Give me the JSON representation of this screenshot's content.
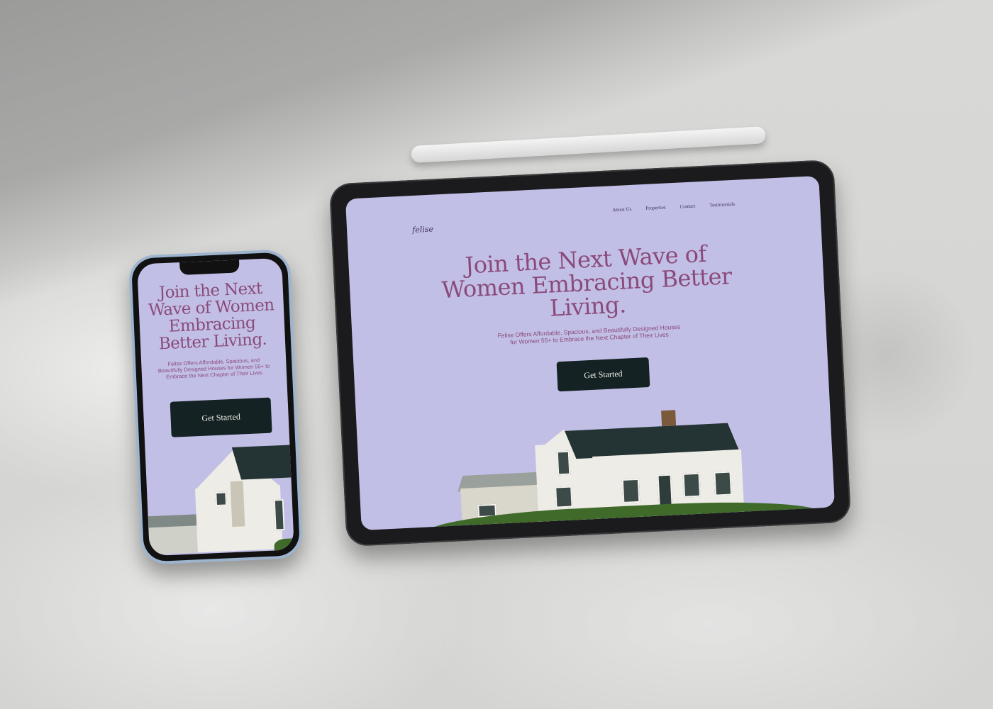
{
  "brand": {
    "logo": "felise"
  },
  "nav": {
    "items": [
      "About Us",
      "Properties",
      "Contact",
      "Testimonials"
    ]
  },
  "hero": {
    "title": "Join the Next Wave of Women Embracing Better Living.",
    "subtitle": "Felise Offers Affordable, Spacious, and Beautifully Designed Houses for Women 55+ to Embrace the Next Chapter of Their Lives",
    "cta_label": "Get Started"
  },
  "colors": {
    "hero_background": "#c2bfe7",
    "headline": "#8a4a79",
    "button": "#152224",
    "button_text": "#f2efe6"
  }
}
